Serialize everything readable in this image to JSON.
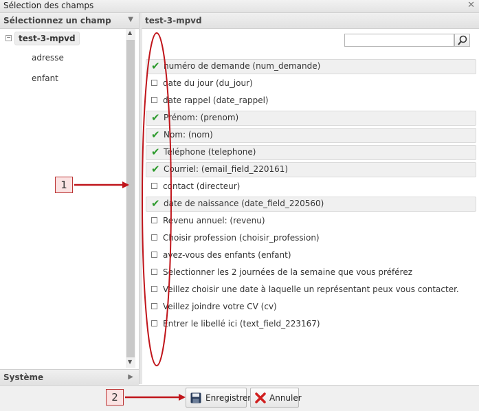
{
  "window": {
    "title": "Sélection des champs"
  },
  "left_panel": {
    "header": "Sélectionnez un champ",
    "tree": {
      "root": "test-3-mpvd",
      "children": [
        "adresse",
        "enfant"
      ]
    },
    "footer": "Système"
  },
  "right_panel": {
    "header": "test-3-mpvd",
    "search": {
      "value": "",
      "placeholder": ""
    },
    "fields": [
      {
        "label": "numéro de demande (num_demande)",
        "checked": true
      },
      {
        "label": "date du jour (du_jour)",
        "checked": false
      },
      {
        "label": "date rappel (date_rappel)",
        "checked": false
      },
      {
        "label": "Prénom: (prenom)",
        "checked": true
      },
      {
        "label": "Nom: (nom)",
        "checked": true
      },
      {
        "label": "Téléphone (telephone)",
        "checked": true
      },
      {
        "label": "Courriel: (email_field_220161)",
        "checked": true
      },
      {
        "label": "contact (directeur)",
        "checked": false
      },
      {
        "label": "date de naissance (date_field_220560)",
        "checked": true
      },
      {
        "label": "Revenu annuel: (revenu)",
        "checked": false
      },
      {
        "label": "Choisir profession (choisir_profession)",
        "checked": false
      },
      {
        "label": "avez-vous des enfants (enfant)",
        "checked": false
      },
      {
        "label": "Selectionner les 2 journées de la semaine que vous préférez",
        "checked": false
      },
      {
        "label": "Veillez choisir une date à laquelle un représentant peux vous contacter.",
        "checked": false
      },
      {
        "label": "Veillez joindre votre CV (cv)",
        "checked": false
      },
      {
        "label": "Entrer le libellé ici (text_field_223167)",
        "checked": false
      }
    ]
  },
  "buttons": {
    "save": "Enregistrer",
    "cancel": "Annuler"
  },
  "annotations": {
    "callout_1": "1",
    "callout_2": "2"
  },
  "colors": {
    "check": "#2c9a2c",
    "annotation": "#c0151b",
    "panel_bg": "#f0f0f0"
  }
}
